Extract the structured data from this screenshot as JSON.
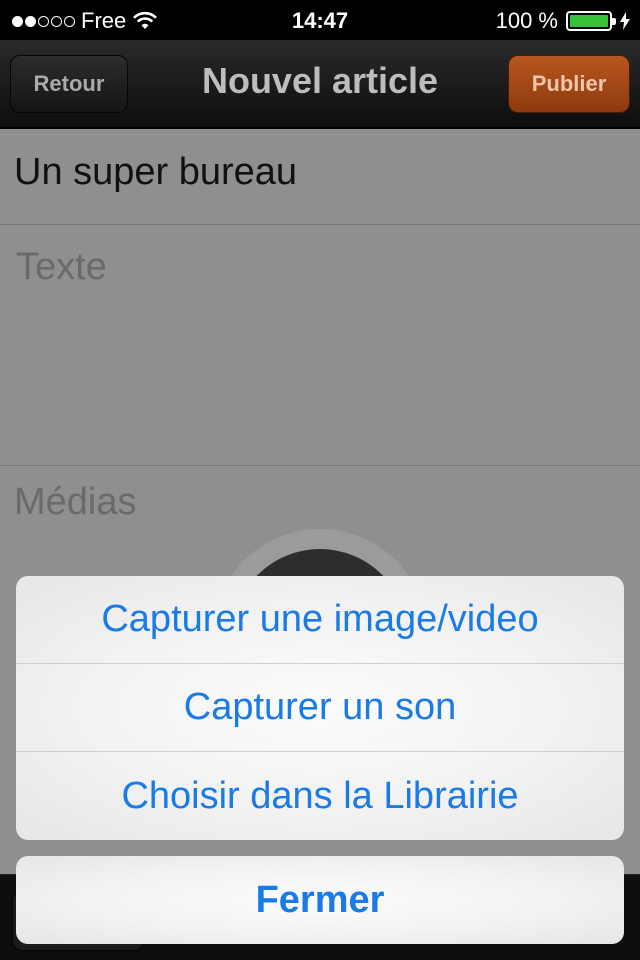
{
  "status_bar": {
    "carrier": "Free",
    "time": "14:47",
    "battery_percent": "100 %",
    "signal_bars_filled": 2,
    "signal_bars_total": 5
  },
  "nav": {
    "back_label": "Retour",
    "title": "Nouvel article",
    "publish_label": "Publier"
  },
  "form": {
    "title_value": "Un super bureau",
    "text_placeholder": "Texte",
    "media_label": "Médias"
  },
  "action_sheet": {
    "items": [
      {
        "label": "Capturer une image/video"
      },
      {
        "label": "Capturer un son"
      },
      {
        "label": "Choisir dans la Librairie"
      }
    ],
    "cancel_label": "Fermer"
  },
  "colors": {
    "accent": "#1a7ae6",
    "publish": "#a84a18",
    "battery": "#35c23a"
  }
}
